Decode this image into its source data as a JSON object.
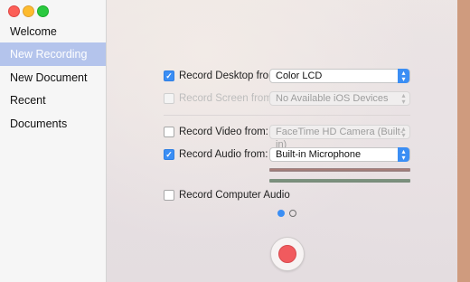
{
  "sidebar": {
    "items": [
      {
        "label": "Welcome",
        "selected": false
      },
      {
        "label": "New Recording",
        "selected": true
      },
      {
        "label": "New Document",
        "selected": false
      },
      {
        "label": "Recent Documents",
        "selected": false
      }
    ]
  },
  "options": {
    "record_desktop": {
      "label": "Record Desktop from:",
      "checked": true,
      "value": "Color LCD"
    },
    "record_screen": {
      "label": "Record Screen from:",
      "checked": false,
      "disabled": true,
      "value": "No Available iOS Devices"
    },
    "record_video": {
      "label": "Record Video from:",
      "checked": false,
      "value": "FaceTime HD Camera (Built-in)"
    },
    "record_audio": {
      "label": "Record Audio from:",
      "checked": true,
      "value": "Built-in Microphone"
    },
    "record_computer_audio": {
      "label": "Record Computer Audio",
      "checked": false
    }
  },
  "pagination": {
    "current": 1,
    "total": 2
  },
  "icons": {
    "check": "checkmark-icon",
    "popup": "chevron-updown-icon",
    "record": "record-icon"
  },
  "colors": {
    "accent": "#3b8ef4",
    "selection": "#b4c4ec",
    "record": "#f15a5e"
  }
}
